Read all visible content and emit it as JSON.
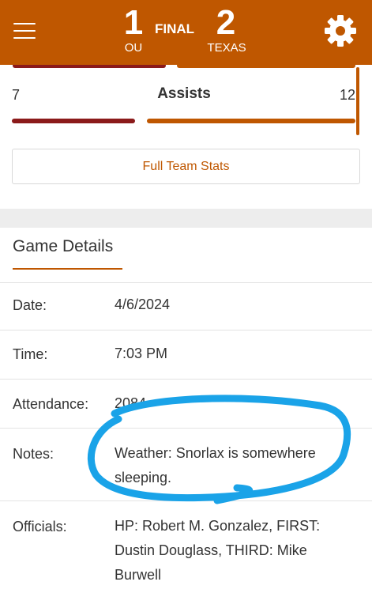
{
  "header": {
    "away_score": "1",
    "away_team": "OU",
    "status": "FINAL",
    "home_score": "2",
    "home_team": "TEXAS"
  },
  "stat": {
    "label": "Assists",
    "away_value": "7",
    "home_value": "12"
  },
  "buttons": {
    "full_team_stats": "Full Team Stats"
  },
  "game_details": {
    "title": "Game Details",
    "rows": [
      {
        "label": "Date:",
        "value": "4/6/2024"
      },
      {
        "label": "Time:",
        "value": "7:03 PM"
      },
      {
        "label": "Attendance:",
        "value": "2084"
      },
      {
        "label": "Notes:",
        "value": "Weather: Snorlax is somewhere sleeping."
      },
      {
        "label": "Officials:",
        "value": "HP: Robert M. Gonzalez, FIRST: Dustin Douglass, THIRD: Mike Burwell"
      }
    ]
  },
  "colors": {
    "accent": "#bf5700",
    "away_bar": "#8b1a1a",
    "annotation": "#1aa3e8"
  },
  "icons": {
    "menu": "hamburger-menu-icon",
    "settings": "gear-icon"
  }
}
